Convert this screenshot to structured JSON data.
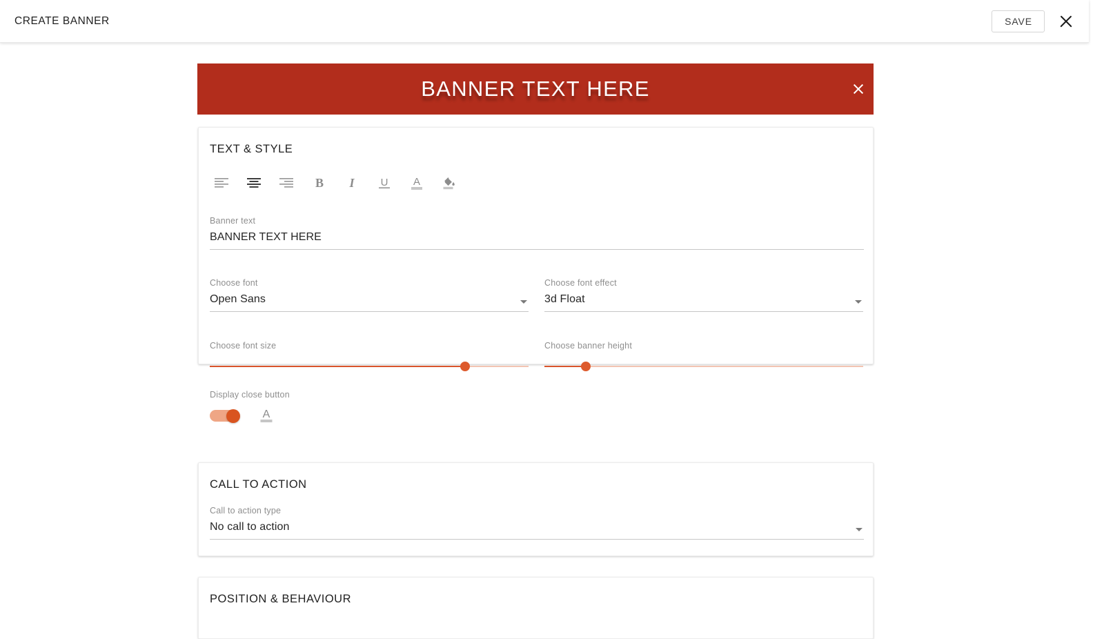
{
  "topbar": {
    "title": "CREATE BANNER",
    "save_label": "SAVE",
    "close_icon": "close-icon"
  },
  "banner_preview": {
    "text": "BANNER TEXT HERE",
    "background_color": "#b22d1c",
    "text_color": "#ffffff",
    "close_icon": "close-icon"
  },
  "text_style_card": {
    "title": "TEXT & STYLE",
    "toolbar": [
      {
        "name": "align-left-icon",
        "label": "Align left",
        "active": false
      },
      {
        "name": "align-center-icon",
        "label": "Align center",
        "active": true
      },
      {
        "name": "align-right-icon",
        "label": "Align right",
        "active": false
      },
      {
        "name": "bold-icon",
        "label": "Bold",
        "active": false
      },
      {
        "name": "italic-icon",
        "label": "Italic",
        "active": false
      },
      {
        "name": "underline-icon",
        "label": "Underline",
        "active": false
      },
      {
        "name": "text-color-icon",
        "label": "Text color",
        "active": false
      },
      {
        "name": "fill-color-icon",
        "label": "Fill color",
        "active": false
      }
    ],
    "banner_text": {
      "label": "Banner text",
      "value": "BANNER TEXT HERE"
    },
    "font": {
      "label": "Choose font",
      "value": "Open Sans"
    },
    "font_effect": {
      "label": "Choose font effect",
      "value": "3d Float"
    },
    "font_size": {
      "label": "Choose font size",
      "percent": 80
    },
    "banner_height": {
      "label": "Choose banner height",
      "percent": 13
    },
    "close_button": {
      "label": "Display close button",
      "enabled": true,
      "color_icon": "text-color-icon"
    }
  },
  "cta_card": {
    "title": "CALL TO ACTION",
    "type": {
      "label": "Call to action type",
      "value": "No call to action"
    }
  },
  "position_card": {
    "title": "POSITION & BEHAVIOUR"
  },
  "colors": {
    "accent": "#d9542b",
    "banner": "#b22d1c"
  }
}
